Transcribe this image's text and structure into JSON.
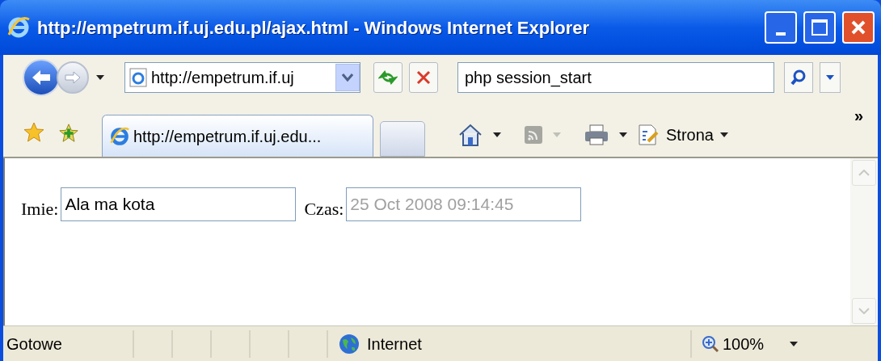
{
  "window": {
    "title": "http://empetrum.if.uj.edu.pl/ajax.html - Windows Internet Explorer"
  },
  "address_bar": {
    "value": "http://empetrum.if.uj"
  },
  "search": {
    "value": "php session_start"
  },
  "tabs": [
    {
      "label": "http://empetrum.if.uj.edu...",
      "selected": true
    }
  ],
  "command_bar": {
    "page_menu": "Strona",
    "chevron": "»"
  },
  "form": {
    "fields": [
      {
        "label": "Imie:",
        "value": "Ala ma kota",
        "disabled": false
      },
      {
        "label": "Czas:",
        "value": "25 Oct 2008 09:14:45",
        "disabled": true
      }
    ]
  },
  "status_bar": {
    "status": "Gotowe",
    "zone": "Internet",
    "zoom": "100%"
  }
}
